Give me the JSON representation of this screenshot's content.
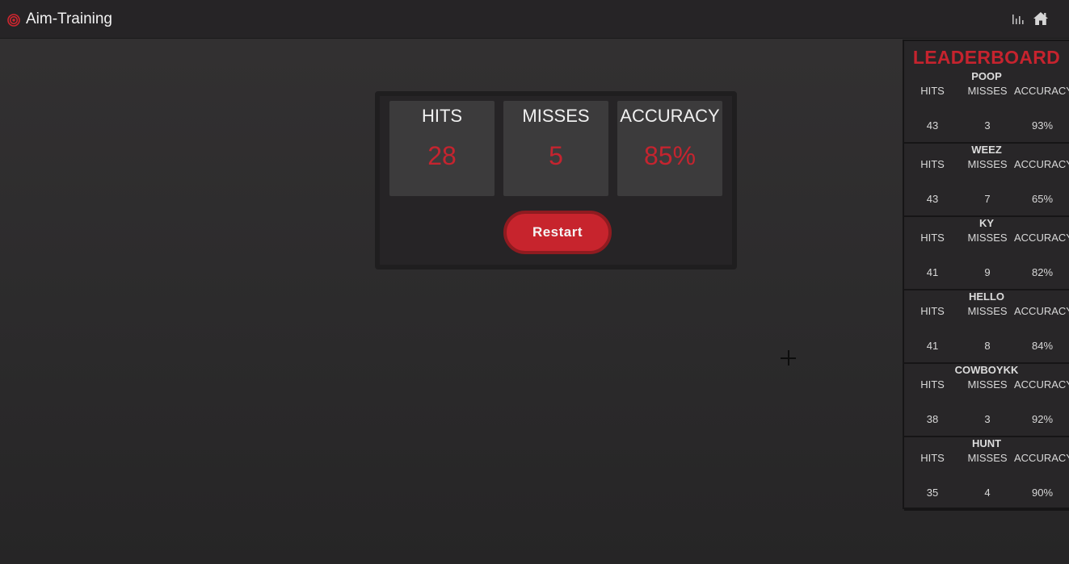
{
  "app": {
    "title": "Aim-Training",
    "accent_color": "#c6232e",
    "icons": [
      "target-logo-icon",
      "bar-chart-icon",
      "home-icon"
    ]
  },
  "results": {
    "stats": [
      {
        "label": "HITS",
        "value": "28"
      },
      {
        "label": "MISSES",
        "value": "5"
      },
      {
        "label": "ACCURACY",
        "value": "85%"
      }
    ],
    "restart_label": "Restart"
  },
  "leaderboard": {
    "title": "LEADERBOARD",
    "columns": [
      "HITS",
      "MISSES",
      "ACCURACY"
    ],
    "entries": [
      {
        "name": "POOP",
        "hits": "43",
        "misses": "3",
        "accuracy": "93%"
      },
      {
        "name": "WEEZ",
        "hits": "43",
        "misses": "7",
        "accuracy": "65%"
      },
      {
        "name": "KY",
        "hits": "41",
        "misses": "9",
        "accuracy": "82%"
      },
      {
        "name": "HELLO",
        "hits": "41",
        "misses": "8",
        "accuracy": "84%"
      },
      {
        "name": "COWBOYKK",
        "hits": "38",
        "misses": "3",
        "accuracy": "92%"
      },
      {
        "name": "HUNT",
        "hits": "35",
        "misses": "4",
        "accuracy": "90%"
      }
    ]
  }
}
